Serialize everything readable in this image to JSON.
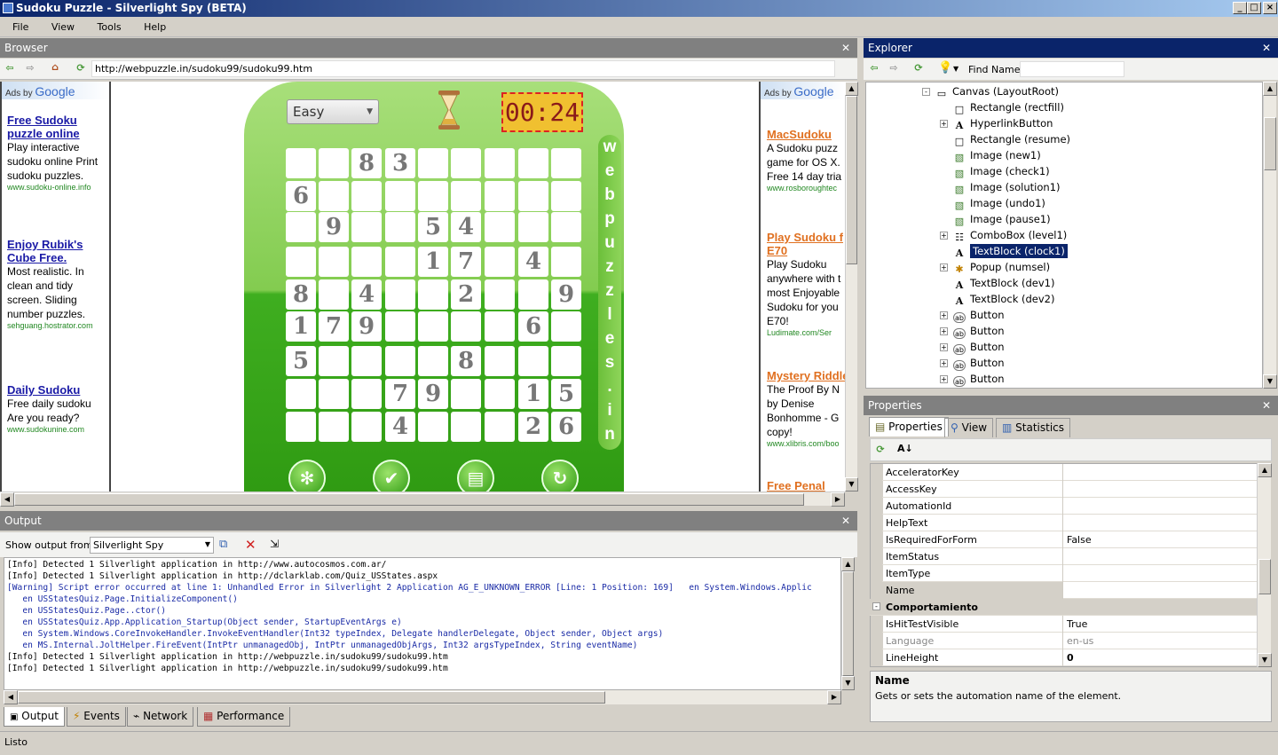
{
  "window": {
    "title": "Sudoku Puzzle - Silverlight Spy (BETA)"
  },
  "menu": [
    "File",
    "View",
    "Tools",
    "Help"
  ],
  "browser": {
    "header": "Browser",
    "url": "http://webpuzzle.in/sudoku99/sudoku99.htm",
    "left_ads": {
      "adsby": "Ads by",
      "google": "Google",
      "items": [
        {
          "title": "Free Sudoku puzzle online",
          "text": "Play interactive sudoku online Print sudoku puzzles.",
          "url": "www.sudoku-online.info"
        },
        {
          "title": "Enjoy Rubik's Cube Free.",
          "text": "Most realistic. In clean and tidy screen. Sliding number puzzles.",
          "url": "sehguang.hostrator.com"
        },
        {
          "title": "Daily Sudoku",
          "text": "Free daily sudoku Are you ready?",
          "url": "www.sudokunine.com"
        }
      ]
    },
    "right_ads": {
      "adsby": "Ads by",
      "google": "Google",
      "items": [
        {
          "title": "MacSudoku",
          "text": "A Sudoku puzz game for OS X. Free 14 day tria",
          "url": "www.rosboroughtec"
        },
        {
          "title": "Play Sudoku f E70",
          "text": "Play Sudoku anywhere with t most Enjoyable Sudoku for you E70!",
          "url": "Ludimate.com/Ser"
        },
        {
          "title": "Mystery Riddle",
          "text": "The Proof By N by Denise Bonhomme - G copy!",
          "url": "www.xlibris.com/boo"
        },
        {
          "title": "Free Penal",
          "text": "",
          "url": ""
        }
      ]
    },
    "game": {
      "difficulty": "Easy",
      "timer": "00:24",
      "side_label": [
        "w",
        "e",
        "b",
        "p",
        "u",
        "z",
        "z",
        "l",
        "e",
        "s",
        ".",
        "i",
        "n"
      ],
      "grid": [
        [
          "",
          "",
          "8",
          "3",
          "",
          "",
          "",
          "",
          ""
        ],
        [
          "6",
          "",
          "",
          "",
          "",
          "",
          "",
          "",
          ""
        ],
        [
          "",
          "9",
          "",
          "",
          "5",
          "4",
          "",
          "",
          ""
        ],
        [
          "",
          "",
          "",
          "",
          "1",
          "7",
          "",
          "4",
          ""
        ],
        [
          "8",
          "",
          "4",
          "",
          "",
          "2",
          "",
          "",
          "9"
        ],
        [
          "1",
          "7",
          "9",
          "",
          "",
          "",
          "",
          "6",
          ""
        ],
        [
          "5",
          "",
          "",
          "",
          "",
          "8",
          "",
          "",
          ""
        ],
        [
          "",
          "",
          "",
          "7",
          "9",
          "",
          "",
          "1",
          "5"
        ],
        [
          "",
          "",
          "",
          "4",
          "",
          "",
          "",
          "2",
          "6"
        ]
      ],
      "buttons": [
        "new-icon",
        "check-icon",
        "solution-icon",
        "undo-icon"
      ]
    }
  },
  "output": {
    "header": "Output",
    "show_from_label": "Show output from:",
    "source": "Silverlight Spy",
    "lines": [
      {
        "t": "[Info] Detected 1 Silverlight application in http://www.autocosmos.com.ar/",
        "w": false
      },
      {
        "t": "[Info] Detected 1 Silverlight application in http://dclarklab.com/Quiz_USStates.aspx",
        "w": false
      },
      {
        "t": "[Warning] Script error occurred at line 1: Unhandled Error in Silverlight 2 Application AG_E_UNKNOWN_ERROR [Line: 1 Position: 169]   en System.Windows.Applic",
        "w": true
      },
      {
        "t": "   en USStatesQuiz.Page.InitializeComponent()",
        "w": true
      },
      {
        "t": "   en USStatesQuiz.Page..ctor()",
        "w": true
      },
      {
        "t": "   en USStatesQuiz.App.Application_Startup(Object sender, StartupEventArgs e)",
        "w": true
      },
      {
        "t": "   en System.Windows.CoreInvokeHandler.InvokeEventHandler(Int32 typeIndex, Delegate handlerDelegate, Object sender, Object args)",
        "w": true
      },
      {
        "t": "   en MS.Internal.JoltHelper.FireEvent(IntPtr unmanagedObj, IntPtr unmanagedObjArgs, Int32 argsTypeIndex, String eventName)",
        "w": true
      },
      {
        "t": "[Info] Detected 1 Silverlight application in http://webpuzzle.in/sudoku99/sudoku99.htm",
        "w": false
      },
      {
        "t": "[Info] Detected 1 Silverlight application in http://webpuzzle.in/sudoku99/sudoku99.htm",
        "w": false
      }
    ],
    "tabs": [
      "Output",
      "Events",
      "Network",
      "Performance"
    ]
  },
  "explorer": {
    "header": "Explorer",
    "find_label": "Find Name:",
    "items": [
      {
        "label": "Canvas (LayoutRoot)",
        "icon": "canvas-icon",
        "indent": 0,
        "expander": "-"
      },
      {
        "label": "Rectangle (rectfill)",
        "icon": "rectangle-icon",
        "indent": 1,
        "expander": ""
      },
      {
        "label": "HyperlinkButton",
        "icon": "text-icon",
        "indent": 1,
        "expander": "+"
      },
      {
        "label": "Rectangle (resume)",
        "icon": "rectangle-icon",
        "indent": 1,
        "expander": ""
      },
      {
        "label": "Image (new1)",
        "icon": "image-icon",
        "indent": 1,
        "expander": ""
      },
      {
        "label": "Image (check1)",
        "icon": "image-icon",
        "indent": 1,
        "expander": ""
      },
      {
        "label": "Image (solution1)",
        "icon": "image-icon",
        "indent": 1,
        "expander": ""
      },
      {
        "label": "Image (undo1)",
        "icon": "image-icon",
        "indent": 1,
        "expander": ""
      },
      {
        "label": "Image (pause1)",
        "icon": "image-icon",
        "indent": 1,
        "expander": ""
      },
      {
        "label": "ComboBox (level1)",
        "icon": "combobox-icon",
        "indent": 1,
        "expander": "+"
      },
      {
        "label": "TextBlock (clock1)",
        "icon": "text-icon",
        "indent": 1,
        "expander": "",
        "selected": true
      },
      {
        "label": "Popup (numsel)",
        "icon": "popup-icon",
        "indent": 1,
        "expander": "+"
      },
      {
        "label": "TextBlock (dev1)",
        "icon": "text-icon",
        "indent": 1,
        "expander": ""
      },
      {
        "label": "TextBlock (dev2)",
        "icon": "text-icon",
        "indent": 1,
        "expander": ""
      },
      {
        "label": "Button",
        "icon": "button-icon",
        "indent": 1,
        "expander": "+"
      },
      {
        "label": "Button",
        "icon": "button-icon",
        "indent": 1,
        "expander": "+"
      },
      {
        "label": "Button",
        "icon": "button-icon",
        "indent": 1,
        "expander": "+"
      },
      {
        "label": "Button",
        "icon": "button-icon",
        "indent": 1,
        "expander": "+"
      },
      {
        "label": "Button",
        "icon": "button-icon",
        "indent": 1,
        "expander": "+"
      }
    ]
  },
  "properties": {
    "header": "Properties",
    "tabs": [
      "Properties",
      "View",
      "Statistics"
    ],
    "rows": [
      {
        "name": "AcceleratorKey",
        "value": "",
        "type": "row"
      },
      {
        "name": "AccessKey",
        "value": "",
        "type": "row"
      },
      {
        "name": "AutomationId",
        "value": "",
        "type": "row"
      },
      {
        "name": "HelpText",
        "value": "",
        "type": "row"
      },
      {
        "name": "IsRequiredForForm",
        "value": "False",
        "type": "row"
      },
      {
        "name": "ItemStatus",
        "value": "",
        "type": "row"
      },
      {
        "name": "ItemType",
        "value": "",
        "type": "row"
      },
      {
        "name": "Name",
        "value": "",
        "type": "selected"
      },
      {
        "name": "Comportamiento",
        "value": "",
        "type": "category"
      },
      {
        "name": "IsHitTestVisible",
        "value": "True",
        "type": "row"
      },
      {
        "name": "Language",
        "value": "en-us",
        "type": "gray"
      },
      {
        "name": "LineHeight",
        "value": "0",
        "type": "bold"
      }
    ],
    "desc_title": "Name",
    "desc_text": "Gets or sets the automation name of the element."
  },
  "status": {
    "text": "Listo"
  },
  "colors": {
    "titlebar": "#0a246a",
    "selection": "#0a246a",
    "board_green": "#83cc50",
    "timer_bg": "#f0c030"
  }
}
